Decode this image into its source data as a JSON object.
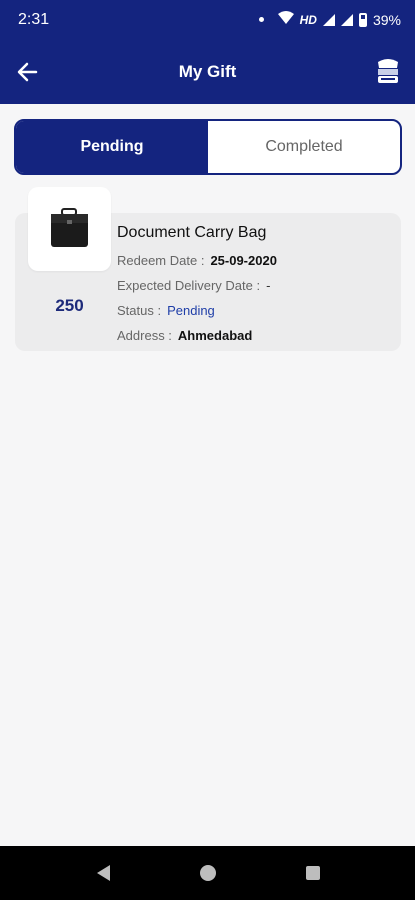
{
  "status_bar": {
    "time": "2:31",
    "network": "HD",
    "battery": "39%"
  },
  "app_bar": {
    "title": "My Gift"
  },
  "tabs": [
    {
      "label": "Pending",
      "active": true
    },
    {
      "label": "Completed",
      "active": false
    }
  ],
  "gift_item": {
    "title": "Document Carry Bag",
    "points": "250",
    "redeem_date_label": "Redeem Date :",
    "redeem_date": "25-09-2020",
    "expected_delivery_label": "Expected Delivery Date :",
    "expected_delivery": "-",
    "status_label": "Status :",
    "status": "Pending",
    "address_label": "Address :",
    "address": "Ahmedabad"
  },
  "colors": {
    "primary": "#14247f",
    "status_text": "#1f3ea8"
  }
}
